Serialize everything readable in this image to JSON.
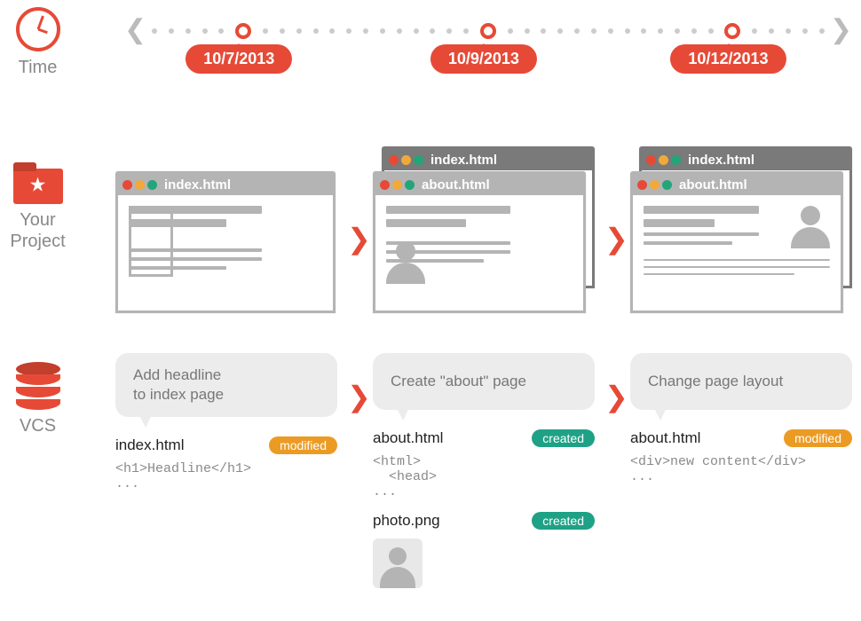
{
  "labels": {
    "time": "Time",
    "project": "Your\nProject",
    "vcs": "VCS"
  },
  "timeline": {
    "dates": [
      "10/7/2013",
      "10/9/2013",
      "10/12/2013"
    ]
  },
  "project": {
    "col1": {
      "tab": "index.html"
    },
    "col2": {
      "back_tab": "index.html",
      "front_tab": "about.html"
    },
    "col3": {
      "back_tab": "index.html",
      "front_tab": "about.html"
    }
  },
  "vcs": {
    "col1": {
      "message": "Add headline\nto index page",
      "file": "index.html",
      "badge": "modified",
      "code": "<h1>Headline</h1>\n..."
    },
    "col2": {
      "message": "Create \"about\" page",
      "file": "about.html",
      "badge": "created",
      "code": "<html>\n  <head>\n...",
      "file2": "photo.png",
      "badge2": "created"
    },
    "col3": {
      "message": "Change page layout",
      "file": "about.html",
      "badge": "modified",
      "code": "<div>new content</div>\n..."
    }
  }
}
